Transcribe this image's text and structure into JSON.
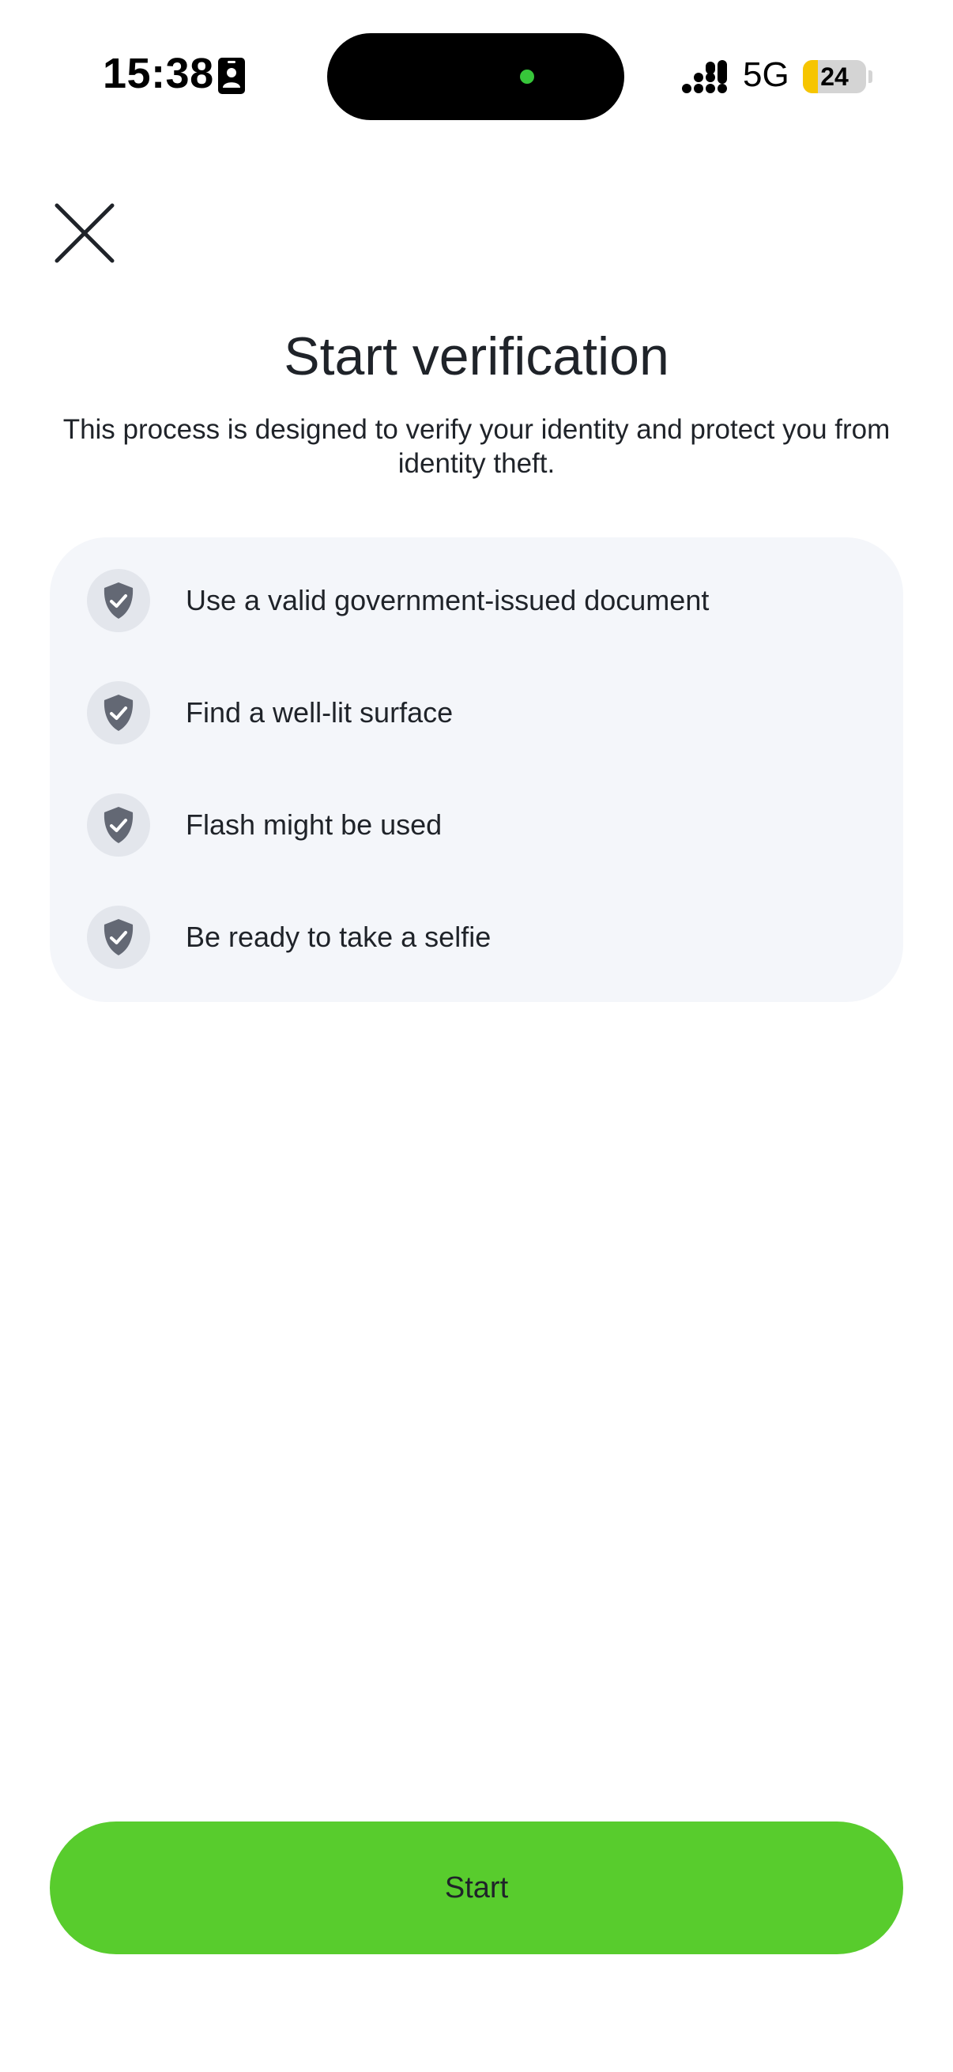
{
  "status_bar": {
    "time": "15:38",
    "network": "5G",
    "battery_level": "24",
    "battery_fraction": 0.24,
    "icons": [
      "contact-card-icon",
      "camera-indicator-icon",
      "cellular-signal-icon",
      "battery-icon"
    ]
  },
  "header": {
    "close_icon": "close-icon"
  },
  "main": {
    "title": "Start verification",
    "subtitle": "This process is designed to verify your identity and protect you from identity theft.",
    "checklist": [
      {
        "icon": "shield-check-icon",
        "label": "Use a valid government-issued document"
      },
      {
        "icon": "shield-check-icon",
        "label": "Find a well-lit surface"
      },
      {
        "icon": "shield-check-icon",
        "label": "Flash might be used"
      },
      {
        "icon": "shield-check-icon",
        "label": "Be ready to take a selfie"
      }
    ]
  },
  "footer": {
    "start_label": "Start"
  },
  "colors": {
    "accent": "#58cc2d",
    "card_background": "#f4f6fa",
    "text": "#1f2329",
    "shield": "#636874",
    "battery": "#f6c500"
  }
}
